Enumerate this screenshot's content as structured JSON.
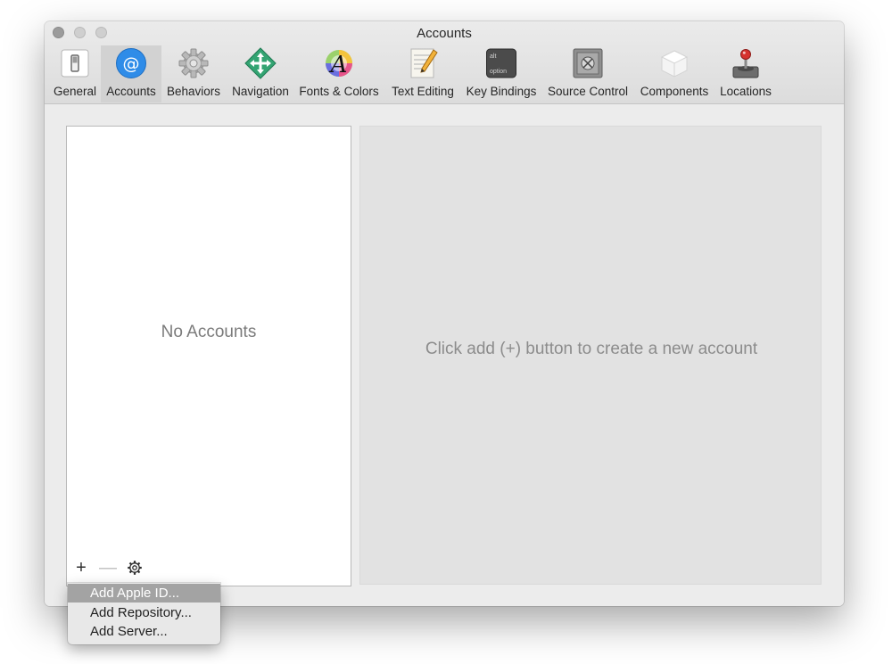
{
  "window": {
    "title": "Accounts"
  },
  "toolbar": {
    "tabs": [
      {
        "label": "General",
        "icon": "switch-icon"
      },
      {
        "label": "Accounts",
        "icon": "at-sign-icon",
        "selected": true
      },
      {
        "label": "Behaviors",
        "icon": "gear-icon"
      },
      {
        "label": "Navigation",
        "icon": "navigation-arrows-icon"
      },
      {
        "label": "Fonts & Colors",
        "icon": "font-color-icon"
      },
      {
        "label": "Text Editing",
        "icon": "text-editing-icon"
      },
      {
        "label": "Key Bindings",
        "icon": "keyboard-key-icon",
        "key_text_top": "alt",
        "key_text_bottom": "option"
      },
      {
        "label": "Source Control",
        "icon": "safe-icon"
      },
      {
        "label": "Components",
        "icon": "component-box-icon"
      },
      {
        "label": "Locations",
        "icon": "joystick-icon"
      }
    ]
  },
  "accounts_list": {
    "empty_text": "No Accounts",
    "add_symbol": "+",
    "remove_symbol": "—"
  },
  "detail": {
    "placeholder": "Click add (+) button to create a new account"
  },
  "add_menu": {
    "items": [
      "Add Apple ID...",
      "Add Repository...",
      "Add Server..."
    ],
    "highlighted_index": 0
  },
  "colors": {
    "selected_tab_bg": "#d2d2d2",
    "accounts_icon_blue": "#2f8ce8",
    "menu_highlight": "#a3a3a3"
  }
}
